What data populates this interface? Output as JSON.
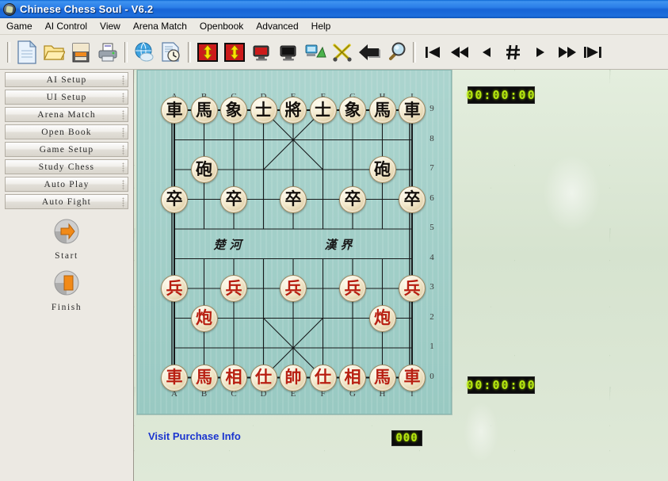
{
  "window": {
    "title": "Chinese Chess Soul - V6.2",
    "app_icon": "app-logo-icon"
  },
  "menubar": {
    "items": [
      {
        "label": "Game"
      },
      {
        "label": "AI Control"
      },
      {
        "label": "View"
      },
      {
        "label": "Arena Match"
      },
      {
        "label": "Openbook"
      },
      {
        "label": "Advanced"
      },
      {
        "label": "Help"
      }
    ]
  },
  "toolbar": {
    "buttons": [
      {
        "name": "new-document-icon",
        "tip": "New"
      },
      {
        "name": "open-folder-icon",
        "tip": "Open"
      },
      {
        "name": "save-icon",
        "tip": "Save"
      },
      {
        "name": "print-icon",
        "tip": "Print"
      },
      {
        "name": "globe-internet-icon",
        "tip": "Internet"
      },
      {
        "name": "document-clock-icon",
        "tip": "Timed Game"
      },
      {
        "name": "red-flip-up-down-icon",
        "tip": "Flip Board"
      },
      {
        "name": "red-flip-up-down-2-icon",
        "tip": "Swap Sides"
      },
      {
        "name": "red-monitor-icon",
        "tip": "Red Engine"
      },
      {
        "name": "black-monitor-icon",
        "tip": "Black Engine"
      },
      {
        "name": "network-computers-icon",
        "tip": "Network"
      },
      {
        "name": "crossed-swords-icon",
        "tip": "Battle"
      },
      {
        "name": "back-arrow-icon",
        "tip": "Back"
      },
      {
        "name": "magnifier-icon",
        "tip": "Zoom"
      },
      {
        "name": "skip-first-icon",
        "tip": "First Move"
      },
      {
        "name": "rewind-icon",
        "tip": "Fast Backward"
      },
      {
        "name": "step-back-icon",
        "tip": "Previous Move"
      },
      {
        "name": "hash-icon",
        "tip": "Move Number"
      },
      {
        "name": "play-icon",
        "tip": "Next Move"
      },
      {
        "name": "fast-forward-icon",
        "tip": "Fast Forward"
      },
      {
        "name": "skip-last-icon",
        "tip": "Last Move"
      }
    ]
  },
  "sidebar": {
    "buttons": [
      {
        "label": "AI Setup"
      },
      {
        "label": "UI Setup"
      },
      {
        "label": "Arena Match"
      },
      {
        "label": "Open Book"
      },
      {
        "label": "Game Setup"
      },
      {
        "label": "Study Chess"
      },
      {
        "label": "Auto Play"
      },
      {
        "label": "Auto Fight"
      }
    ],
    "actions": [
      {
        "label": "Start",
        "icon": "start-arrow-icon"
      },
      {
        "label": "Finish",
        "icon": "finish-stop-icon"
      }
    ]
  },
  "board": {
    "files": [
      "A",
      "B",
      "C",
      "D",
      "E",
      "F",
      "G",
      "H",
      "I"
    ],
    "ranks": [
      "9",
      "8",
      "7",
      "6",
      "5",
      "4",
      "3",
      "2",
      "1",
      "0"
    ],
    "river_left": "楚河",
    "river_right": "漢界",
    "pieces": [
      {
        "glyph": "車",
        "side": "black",
        "file": 0,
        "rank": 9
      },
      {
        "glyph": "馬",
        "side": "black",
        "file": 1,
        "rank": 9
      },
      {
        "glyph": "象",
        "side": "black",
        "file": 2,
        "rank": 9
      },
      {
        "glyph": "士",
        "side": "black",
        "file": 3,
        "rank": 9
      },
      {
        "glyph": "將",
        "side": "black",
        "file": 4,
        "rank": 9
      },
      {
        "glyph": "士",
        "side": "black",
        "file": 5,
        "rank": 9
      },
      {
        "glyph": "象",
        "side": "black",
        "file": 6,
        "rank": 9
      },
      {
        "glyph": "馬",
        "side": "black",
        "file": 7,
        "rank": 9
      },
      {
        "glyph": "車",
        "side": "black",
        "file": 8,
        "rank": 9
      },
      {
        "glyph": "砲",
        "side": "black",
        "file": 1,
        "rank": 7
      },
      {
        "glyph": "砲",
        "side": "black",
        "file": 7,
        "rank": 7
      },
      {
        "glyph": "卒",
        "side": "black",
        "file": 0,
        "rank": 6
      },
      {
        "glyph": "卒",
        "side": "black",
        "file": 2,
        "rank": 6
      },
      {
        "glyph": "卒",
        "side": "black",
        "file": 4,
        "rank": 6
      },
      {
        "glyph": "卒",
        "side": "black",
        "file": 6,
        "rank": 6
      },
      {
        "glyph": "卒",
        "side": "black",
        "file": 8,
        "rank": 6
      },
      {
        "glyph": "兵",
        "side": "red",
        "file": 0,
        "rank": 3
      },
      {
        "glyph": "兵",
        "side": "red",
        "file": 2,
        "rank": 3
      },
      {
        "glyph": "兵",
        "side": "red",
        "file": 4,
        "rank": 3
      },
      {
        "glyph": "兵",
        "side": "red",
        "file": 6,
        "rank": 3
      },
      {
        "glyph": "兵",
        "side": "red",
        "file": 8,
        "rank": 3
      },
      {
        "glyph": "炮",
        "side": "red",
        "file": 1,
        "rank": 2
      },
      {
        "glyph": "炮",
        "side": "red",
        "file": 7,
        "rank": 2
      },
      {
        "glyph": "車",
        "side": "red",
        "file": 0,
        "rank": 0
      },
      {
        "glyph": "馬",
        "side": "red",
        "file": 1,
        "rank": 0
      },
      {
        "glyph": "相",
        "side": "red",
        "file": 2,
        "rank": 0
      },
      {
        "glyph": "仕",
        "side": "red",
        "file": 3,
        "rank": 0
      },
      {
        "glyph": "帥",
        "side": "red",
        "file": 4,
        "rank": 0
      },
      {
        "glyph": "仕",
        "side": "red",
        "file": 5,
        "rank": 0
      },
      {
        "glyph": "相",
        "side": "red",
        "file": 6,
        "rank": 0
      },
      {
        "glyph": "馬",
        "side": "red",
        "file": 7,
        "rank": 0
      },
      {
        "glyph": "車",
        "side": "red",
        "file": 8,
        "rank": 0
      }
    ]
  },
  "status": {
    "clock_black": "00:00:00",
    "clock_red": "00:00:00",
    "move_counter": "000",
    "purchase_link": "Visit Purchase Info"
  },
  "colors": {
    "titlebar_blue": "#1764d6",
    "board_teal": "#9fcec7",
    "panel_green": "#dce8d6",
    "lcd_green": "#b6e80f",
    "red_piece": "#b81f12",
    "black_piece": "#14100c",
    "link_blue": "#1b35cf"
  }
}
